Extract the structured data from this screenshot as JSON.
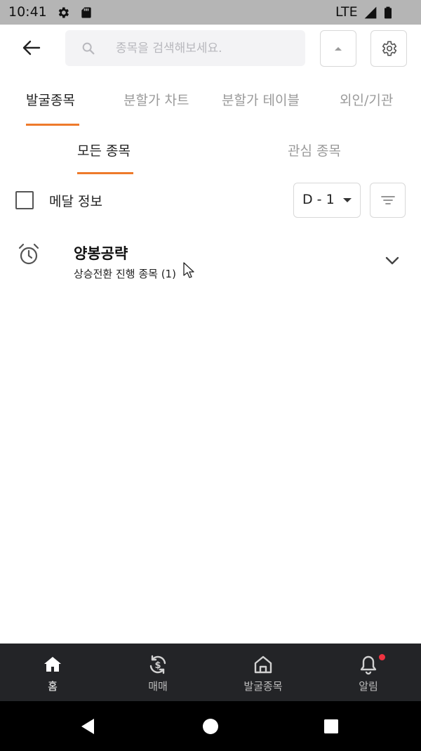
{
  "status_bar": {
    "time": "10:41",
    "network": "LTE"
  },
  "search": {
    "placeholder": "종목을 검색해보세요.",
    "value": ""
  },
  "tabs": [
    {
      "label": "발굴종목",
      "active": true
    },
    {
      "label": "분할가 차트",
      "active": false
    },
    {
      "label": "분할가 테이블",
      "active": false
    },
    {
      "label": "외인/기관",
      "active": false
    }
  ],
  "subtabs": [
    {
      "label": "모든 종목",
      "active": true
    },
    {
      "label": "관심 종목",
      "active": false
    }
  ],
  "filter": {
    "checkbox_label": "메달 정보",
    "checked": false,
    "dropdown_value": "D - 1"
  },
  "list": [
    {
      "title": "양봉공략",
      "subtitle": "상승전환 진행 종목 (1)"
    }
  ],
  "bottom_nav": [
    {
      "label": "홈",
      "icon": "home-icon",
      "active": true
    },
    {
      "label": "매매",
      "icon": "trade-icon",
      "active": false
    },
    {
      "label": "발굴종목",
      "icon": "discover-icon",
      "active": false
    },
    {
      "label": "알림",
      "icon": "bell-icon",
      "active": false,
      "badge": true
    }
  ],
  "colors": {
    "accent": "#ee7a2b",
    "badge": "#ef3340",
    "nav_bg": "#232427"
  }
}
